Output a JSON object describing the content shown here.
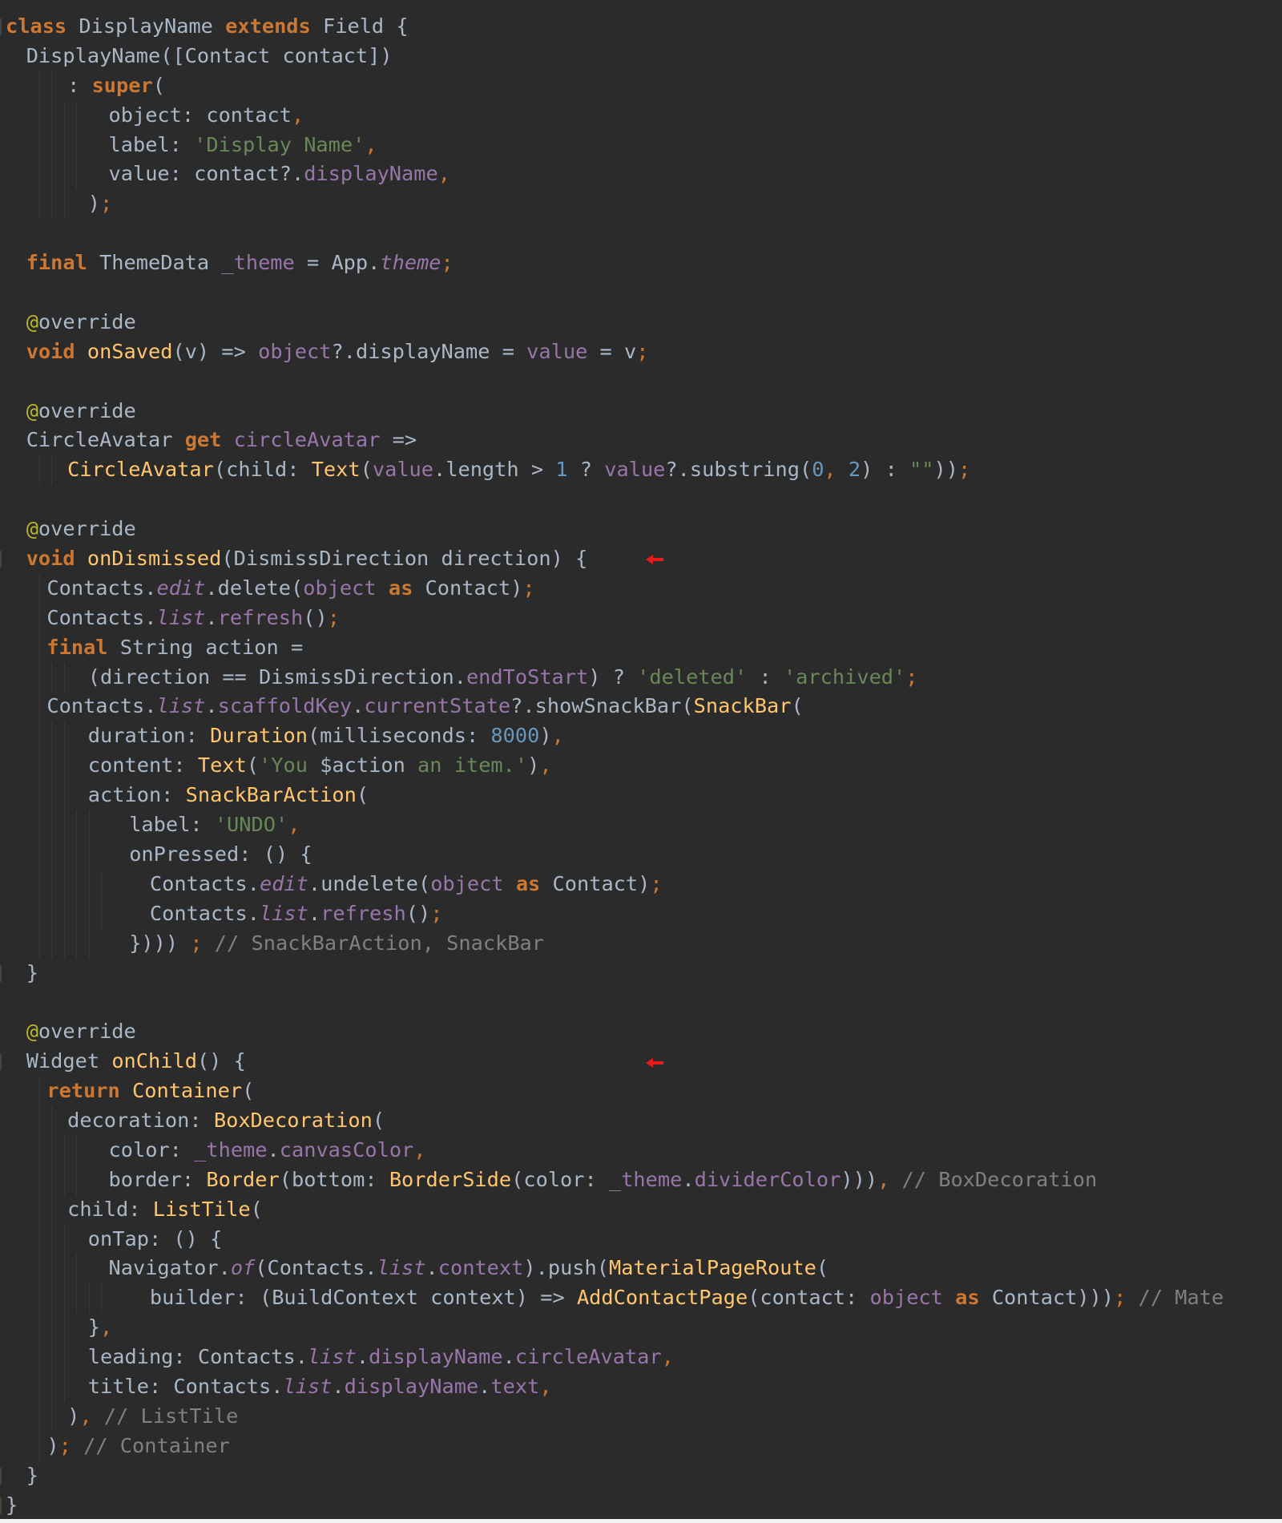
{
  "editor": {
    "theme_colors": {
      "background": "#2b2b2b",
      "keyword": "#cc7832",
      "function": "#ffc66d",
      "string": "#6a8759",
      "number": "#6897bb",
      "property": "#9876aa",
      "annotation": "#bbb529",
      "comment": "#808080",
      "plain": "#a9b7c6",
      "marker_arrow": "#e81c1c"
    },
    "markers": [
      {
        "name": "red-arrow-icon",
        "line": 18
      },
      {
        "name": "red-arrow-icon",
        "line": 35
      }
    ],
    "lines": [
      {
        "indent": 0,
        "tokens": [
          [
            "kw",
            "class"
          ],
          [
            "plain",
            " DisplayName "
          ],
          [
            "kw",
            "extends"
          ],
          [
            "plain",
            " Field {"
          ]
        ]
      },
      {
        "indent": 1,
        "tokens": [
          [
            "plain",
            "DisplayName([Contact contact])"
          ]
        ]
      },
      {
        "indent": 3,
        "tokens": [
          [
            "plain",
            ": "
          ],
          [
            "kw",
            "super"
          ],
          [
            "plain",
            "("
          ]
        ]
      },
      {
        "indent": 5,
        "tokens": [
          [
            "plain",
            "object: contact"
          ],
          [
            "punc",
            ","
          ]
        ]
      },
      {
        "indent": 5,
        "tokens": [
          [
            "plain",
            "label: "
          ],
          [
            "str",
            "'Display Name'"
          ],
          [
            "punc",
            ","
          ]
        ]
      },
      {
        "indent": 5,
        "tokens": [
          [
            "plain",
            "value: contact?."
          ],
          [
            "prop",
            "displayName"
          ],
          [
            "punc",
            ","
          ]
        ]
      },
      {
        "indent": 4,
        "tokens": [
          [
            "plain",
            ")"
          ],
          [
            "punc",
            ";"
          ]
        ]
      },
      {
        "indent": 0,
        "tokens": []
      },
      {
        "indent": 1,
        "tokens": [
          [
            "kw",
            "final"
          ],
          [
            "plain",
            " ThemeData "
          ],
          [
            "prop",
            "_theme"
          ],
          [
            "plain",
            " = App."
          ],
          [
            "ital",
            "theme"
          ],
          [
            "punc",
            ";"
          ]
        ]
      },
      {
        "indent": 0,
        "tokens": []
      },
      {
        "indent": 1,
        "tokens": [
          [
            "ann",
            "@"
          ],
          [
            "plain",
            "override"
          ]
        ]
      },
      {
        "indent": 1,
        "tokens": [
          [
            "kw",
            "void"
          ],
          [
            "plain",
            " "
          ],
          [
            "fn",
            "onSaved"
          ],
          [
            "plain",
            "(v) => "
          ],
          [
            "prop",
            "object"
          ],
          [
            "plain",
            "?.displayName = "
          ],
          [
            "prop",
            "value"
          ],
          [
            "plain",
            " = v"
          ],
          [
            "punc",
            ";"
          ]
        ]
      },
      {
        "indent": 0,
        "tokens": []
      },
      {
        "indent": 1,
        "tokens": [
          [
            "ann",
            "@"
          ],
          [
            "plain",
            "override"
          ]
        ]
      },
      {
        "indent": 1,
        "tokens": [
          [
            "plain",
            "CircleAvatar "
          ],
          [
            "kw",
            "get"
          ],
          [
            "plain",
            " "
          ],
          [
            "prop",
            "circleAvatar"
          ],
          [
            "plain",
            " =>"
          ]
        ]
      },
      {
        "indent": 3,
        "tokens": [
          [
            "fn",
            "CircleAvatar"
          ],
          [
            "plain",
            "(child: "
          ],
          [
            "fn",
            "Text"
          ],
          [
            "plain",
            "("
          ],
          [
            "prop",
            "value"
          ],
          [
            "plain",
            ".length > "
          ],
          [
            "num",
            "1"
          ],
          [
            "plain",
            " ? "
          ],
          [
            "prop",
            "value"
          ],
          [
            "plain",
            "?.substring("
          ],
          [
            "num",
            "0"
          ],
          [
            "punc",
            ","
          ],
          [
            "plain",
            " "
          ],
          [
            "num",
            "2"
          ],
          [
            "plain",
            ") : "
          ],
          [
            "str",
            "\"\""
          ],
          [
            "plain",
            "))"
          ],
          [
            "punc",
            ";"
          ]
        ]
      },
      {
        "indent": 0,
        "tokens": []
      },
      {
        "indent": 1,
        "tokens": [
          [
            "ann",
            "@"
          ],
          [
            "plain",
            "override"
          ]
        ]
      },
      {
        "indent": 1,
        "tokens": [
          [
            "kw",
            "void"
          ],
          [
            "plain",
            " "
          ],
          [
            "fn",
            "onDismissed"
          ],
          [
            "plain",
            "(DismissDirection direction) {"
          ]
        ]
      },
      {
        "indent": 2,
        "tokens": [
          [
            "plain",
            "Contacts."
          ],
          [
            "ital",
            "edit"
          ],
          [
            "plain",
            ".delete("
          ],
          [
            "prop",
            "object"
          ],
          [
            "plain",
            " "
          ],
          [
            "kw",
            "as"
          ],
          [
            "plain",
            " Contact)"
          ],
          [
            "punc",
            ";"
          ]
        ]
      },
      {
        "indent": 2,
        "tokens": [
          [
            "plain",
            "Contacts."
          ],
          [
            "ital",
            "list"
          ],
          [
            "plain",
            "."
          ],
          [
            "prop",
            "refresh"
          ],
          [
            "plain",
            "()"
          ],
          [
            "punc",
            ";"
          ]
        ]
      },
      {
        "indent": 2,
        "tokens": [
          [
            "kw",
            "final"
          ],
          [
            "plain",
            " String action ="
          ]
        ]
      },
      {
        "indent": 4,
        "tokens": [
          [
            "plain",
            "(direction == DismissDirection."
          ],
          [
            "prop",
            "endToStart"
          ],
          [
            "plain",
            ") ? "
          ],
          [
            "str",
            "'deleted'"
          ],
          [
            "plain",
            " : "
          ],
          [
            "str",
            "'archived'"
          ],
          [
            "punc",
            ";"
          ]
        ]
      },
      {
        "indent": 2,
        "tokens": [
          [
            "plain",
            "Contacts."
          ],
          [
            "ital",
            "list"
          ],
          [
            "plain",
            "."
          ],
          [
            "prop",
            "scaffoldKey"
          ],
          [
            "plain",
            "."
          ],
          [
            "prop",
            "currentState"
          ],
          [
            "plain",
            "?.showSnackBar("
          ],
          [
            "fn",
            "SnackBar"
          ],
          [
            "plain",
            "("
          ]
        ]
      },
      {
        "indent": 4,
        "tokens": [
          [
            "plain",
            "duration: "
          ],
          [
            "fn",
            "Duration"
          ],
          [
            "plain",
            "(milliseconds: "
          ],
          [
            "num",
            "8000"
          ],
          [
            "plain",
            ")"
          ],
          [
            "punc",
            ","
          ]
        ]
      },
      {
        "indent": 4,
        "tokens": [
          [
            "plain",
            "content: "
          ],
          [
            "fn",
            "Text"
          ],
          [
            "plain",
            "("
          ],
          [
            "str",
            "'You "
          ],
          [
            "plain",
            "$action"
          ],
          [
            "str",
            " an item.'"
          ],
          [
            "plain",
            ")"
          ],
          [
            "punc",
            ","
          ]
        ]
      },
      {
        "indent": 4,
        "tokens": [
          [
            "plain",
            "action: "
          ],
          [
            "fn",
            "SnackBarAction"
          ],
          [
            "plain",
            "("
          ]
        ]
      },
      {
        "indent": 6,
        "tokens": [
          [
            "plain",
            "label: "
          ],
          [
            "str",
            "'UNDO'"
          ],
          [
            "punc",
            ","
          ]
        ]
      },
      {
        "indent": 6,
        "tokens": [
          [
            "plain",
            "onPressed: () {"
          ]
        ]
      },
      {
        "indent": 7,
        "tokens": [
          [
            "plain",
            "Contacts."
          ],
          [
            "ital",
            "edit"
          ],
          [
            "plain",
            ".undelete("
          ],
          [
            "prop",
            "object"
          ],
          [
            "plain",
            " "
          ],
          [
            "kw",
            "as"
          ],
          [
            "plain",
            " Contact)"
          ],
          [
            "punc",
            ";"
          ]
        ]
      },
      {
        "indent": 7,
        "tokens": [
          [
            "plain",
            "Contacts."
          ],
          [
            "ital",
            "list"
          ],
          [
            "plain",
            "."
          ],
          [
            "prop",
            "refresh"
          ],
          [
            "plain",
            "()"
          ],
          [
            "punc",
            ";"
          ]
        ]
      },
      {
        "indent": 6,
        "tokens": [
          [
            "plain",
            "}))) "
          ],
          [
            "punc",
            ";"
          ],
          [
            "cmt",
            " // SnackBarAction, SnackBar"
          ]
        ]
      },
      {
        "indent": 1,
        "tokens": [
          [
            "plain",
            "}"
          ]
        ]
      },
      {
        "indent": 0,
        "tokens": []
      },
      {
        "indent": 1,
        "tokens": [
          [
            "ann",
            "@"
          ],
          [
            "plain",
            "override"
          ]
        ]
      },
      {
        "indent": 1,
        "tokens": [
          [
            "plain",
            "Widget "
          ],
          [
            "fn",
            "onChild"
          ],
          [
            "plain",
            "() {"
          ]
        ]
      },
      {
        "indent": 2,
        "tokens": [
          [
            "kw",
            "return"
          ],
          [
            "plain",
            " "
          ],
          [
            "fn",
            "Container"
          ],
          [
            "plain",
            "("
          ]
        ]
      },
      {
        "indent": 3,
        "tokens": [
          [
            "plain",
            "decoration: "
          ],
          [
            "fn",
            "BoxDecoration"
          ],
          [
            "plain",
            "("
          ]
        ]
      },
      {
        "indent": 5,
        "tokens": [
          [
            "plain",
            "color: "
          ],
          [
            "prop",
            "_theme"
          ],
          [
            "plain",
            "."
          ],
          [
            "prop",
            "canvasColor"
          ],
          [
            "punc",
            ","
          ]
        ]
      },
      {
        "indent": 5,
        "tokens": [
          [
            "plain",
            "border: "
          ],
          [
            "fn",
            "Border"
          ],
          [
            "plain",
            "(bottom: "
          ],
          [
            "fn",
            "BorderSide"
          ],
          [
            "plain",
            "(color: "
          ],
          [
            "prop",
            "_theme"
          ],
          [
            "plain",
            "."
          ],
          [
            "prop",
            "dividerColor"
          ],
          [
            "plain",
            ")))"
          ],
          [
            "punc",
            ","
          ],
          [
            "cmt",
            " // BoxDecoration"
          ]
        ]
      },
      {
        "indent": 3,
        "tokens": [
          [
            "plain",
            "child: "
          ],
          [
            "fn",
            "ListTile"
          ],
          [
            "plain",
            "("
          ]
        ]
      },
      {
        "indent": 4,
        "tokens": [
          [
            "plain",
            "onTap: () {"
          ]
        ]
      },
      {
        "indent": 5,
        "tokens": [
          [
            "plain",
            "Navigator."
          ],
          [
            "ital",
            "of"
          ],
          [
            "plain",
            "(Contacts."
          ],
          [
            "ital",
            "list"
          ],
          [
            "plain",
            "."
          ],
          [
            "prop",
            "context"
          ],
          [
            "plain",
            ").push("
          ],
          [
            "fn",
            "MaterialPageRoute"
          ],
          [
            "plain",
            "("
          ]
        ]
      },
      {
        "indent": 7,
        "tokens": [
          [
            "plain",
            "builder: (BuildContext context) => "
          ],
          [
            "fn",
            "AddContactPage"
          ],
          [
            "plain",
            "(contact: "
          ],
          [
            "prop",
            "object"
          ],
          [
            "plain",
            " "
          ],
          [
            "kw",
            "as"
          ],
          [
            "plain",
            " Contact)))"
          ],
          [
            "punc",
            ";"
          ],
          [
            "cmt",
            " // Mate"
          ]
        ]
      },
      {
        "indent": 4,
        "tokens": [
          [
            "plain",
            "}"
          ],
          [
            "punc",
            ","
          ]
        ]
      },
      {
        "indent": 4,
        "tokens": [
          [
            "plain",
            "leading: Contacts."
          ],
          [
            "ital",
            "list"
          ],
          [
            "plain",
            "."
          ],
          [
            "prop",
            "displayName"
          ],
          [
            "plain",
            "."
          ],
          [
            "prop",
            "circleAvatar"
          ],
          [
            "punc",
            ","
          ]
        ]
      },
      {
        "indent": 4,
        "tokens": [
          [
            "plain",
            "title: Contacts."
          ],
          [
            "ital",
            "list"
          ],
          [
            "plain",
            "."
          ],
          [
            "prop",
            "displayName"
          ],
          [
            "plain",
            "."
          ],
          [
            "prop",
            "text"
          ],
          [
            "punc",
            ","
          ]
        ]
      },
      {
        "indent": 3,
        "tokens": [
          [
            "plain",
            ")"
          ],
          [
            "punc",
            ","
          ],
          [
            "cmt",
            " // ListTile"
          ]
        ]
      },
      {
        "indent": 2,
        "tokens": [
          [
            "plain",
            ")"
          ],
          [
            "punc",
            ";"
          ],
          [
            "cmt",
            " // Container"
          ]
        ]
      },
      {
        "indent": 1,
        "tokens": [
          [
            "plain",
            "}"
          ]
        ]
      },
      {
        "indent": 0,
        "tokens": [
          [
            "plain",
            "}"
          ]
        ]
      }
    ]
  }
}
